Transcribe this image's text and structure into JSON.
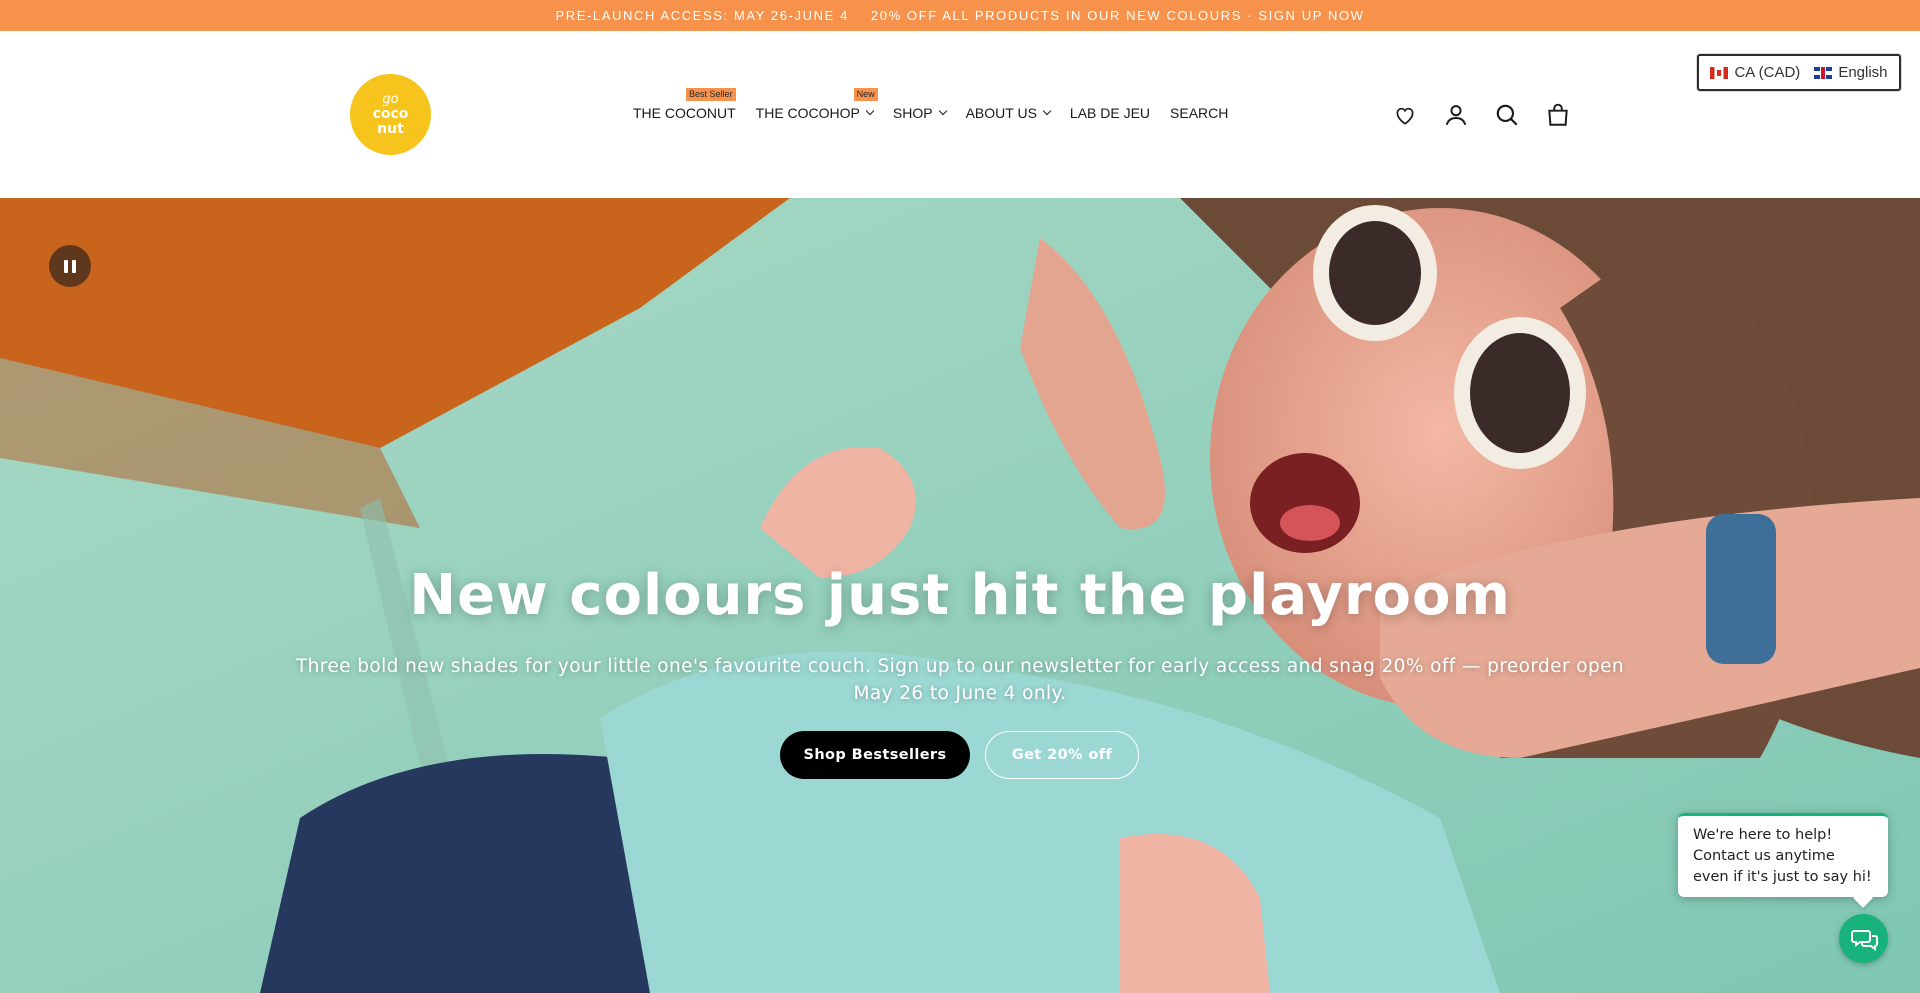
{
  "announcement": {
    "part1": "PRE-LAUNCH ACCESS: MAY 26-JUNE 4",
    "part2": "20% OFF ALL PRODUCTS IN OUR NEW COLOURS · SIGN UP NOW"
  },
  "logo": {
    "line1": "go",
    "line2": "coco",
    "line3": "nut",
    "color": "#f6c41c"
  },
  "nav": {
    "items": [
      {
        "label": "THE COCONUT",
        "badge": "Best Seller",
        "dropdown": false
      },
      {
        "label": "THE COCOHOP",
        "badge": "New",
        "dropdown": true
      },
      {
        "label": "SHOP",
        "dropdown": true
      },
      {
        "label": "ABOUT US",
        "dropdown": true
      },
      {
        "label": "LAB DE JEU",
        "dropdown": false
      },
      {
        "label": "SEARCH",
        "dropdown": false
      }
    ]
  },
  "header_icons": [
    "heart-icon",
    "account-icon",
    "search-icon",
    "cart-icon"
  ],
  "locale": {
    "currency": "CA (CAD)",
    "language": "English"
  },
  "hero": {
    "title": "New colours just hit the playroom",
    "subtitle": "Three bold new shades for your little one's favourite couch. Sign up to our newsletter for early access and snag 20% off — preorder open May 26 to June 4 only.",
    "primary_button": "Shop Bestsellers",
    "secondary_button": "Get 20% off"
  },
  "chat": {
    "message": "We're here to help! Contact us anytime even if it's just to say hi!"
  },
  "colors": {
    "announcement_bg": "#f6924c",
    "badge_bg": "#f6924c",
    "chat_green": "#18b27d"
  }
}
